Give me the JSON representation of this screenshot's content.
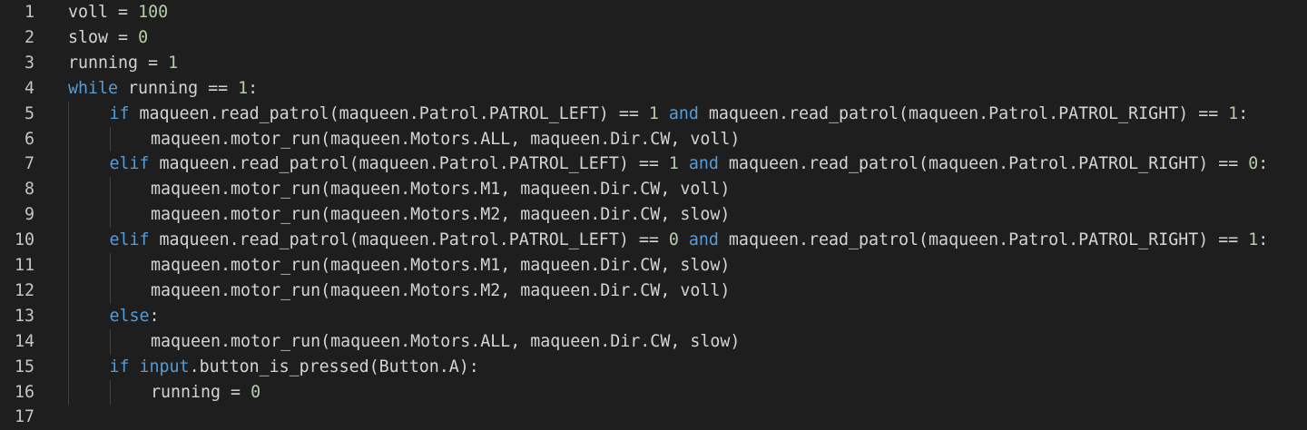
{
  "editor": {
    "lines": [
      {
        "no": "1",
        "indent": 0,
        "tokens": [
          {
            "t": "voll",
            "k": "id"
          },
          {
            "t": " = ",
            "k": "op"
          },
          {
            "t": "100",
            "k": "num"
          }
        ]
      },
      {
        "no": "2",
        "indent": 0,
        "tokens": [
          {
            "t": "slow",
            "k": "id"
          },
          {
            "t": " = ",
            "k": "op"
          },
          {
            "t": "0",
            "k": "num"
          }
        ]
      },
      {
        "no": "3",
        "indent": 0,
        "tokens": [
          {
            "t": "running",
            "k": "id"
          },
          {
            "t": " = ",
            "k": "op"
          },
          {
            "t": "1",
            "k": "num"
          }
        ]
      },
      {
        "no": "4",
        "indent": 0,
        "tokens": [
          {
            "t": "while",
            "k": "kw"
          },
          {
            "t": " running == ",
            "k": "id"
          },
          {
            "t": "1",
            "k": "num"
          },
          {
            "t": ":",
            "k": "op"
          }
        ]
      },
      {
        "no": "5",
        "indent": 1,
        "tokens": [
          {
            "t": "if",
            "k": "kw"
          },
          {
            "t": " maqueen.read_patrol(maqueen.Patrol.PATROL_LEFT) == ",
            "k": "id"
          },
          {
            "t": "1",
            "k": "num"
          },
          {
            "t": " ",
            "k": "op"
          },
          {
            "t": "and",
            "k": "kw"
          },
          {
            "t": " maqueen.read_patrol(maqueen.Patrol.PATROL_RIGHT) == ",
            "k": "id"
          },
          {
            "t": "1",
            "k": "num"
          },
          {
            "t": ":",
            "k": "op"
          }
        ]
      },
      {
        "no": "6",
        "indent": 2,
        "tokens": [
          {
            "t": "maqueen.motor_run(maqueen.Motors.ALL, maqueen.Dir.CW, voll)",
            "k": "id"
          }
        ]
      },
      {
        "no": "7",
        "indent": 1,
        "tokens": [
          {
            "t": "elif",
            "k": "kw"
          },
          {
            "t": " maqueen.read_patrol(maqueen.Patrol.PATROL_LEFT) == ",
            "k": "id"
          },
          {
            "t": "1",
            "k": "num"
          },
          {
            "t": " ",
            "k": "op"
          },
          {
            "t": "and",
            "k": "kw"
          },
          {
            "t": " maqueen.read_patrol(maqueen.Patrol.PATROL_RIGHT) == ",
            "k": "id"
          },
          {
            "t": "0",
            "k": "num"
          },
          {
            "t": ":",
            "k": "op"
          }
        ]
      },
      {
        "no": "8",
        "indent": 2,
        "tokens": [
          {
            "t": "maqueen.motor_run(maqueen.Motors.M1, maqueen.Dir.CW, voll)",
            "k": "id"
          }
        ]
      },
      {
        "no": "9",
        "indent": 2,
        "tokens": [
          {
            "t": "maqueen.motor_run(maqueen.Motors.M2, maqueen.Dir.CW, slow)",
            "k": "id"
          }
        ]
      },
      {
        "no": "10",
        "indent": 1,
        "tokens": [
          {
            "t": "elif",
            "k": "kw"
          },
          {
            "t": " maqueen.read_patrol(maqueen.Patrol.PATROL_LEFT) == ",
            "k": "id"
          },
          {
            "t": "0",
            "k": "num"
          },
          {
            "t": " ",
            "k": "op"
          },
          {
            "t": "and",
            "k": "kw"
          },
          {
            "t": " maqueen.read_patrol(maqueen.Patrol.PATROL_RIGHT) == ",
            "k": "id"
          },
          {
            "t": "1",
            "k": "num"
          },
          {
            "t": ":",
            "k": "op"
          }
        ]
      },
      {
        "no": "11",
        "indent": 2,
        "tokens": [
          {
            "t": "maqueen.motor_run(maqueen.Motors.M1, maqueen.Dir.CW, slow)",
            "k": "id"
          }
        ]
      },
      {
        "no": "12",
        "indent": 2,
        "tokens": [
          {
            "t": "maqueen.motor_run(maqueen.Motors.M2, maqueen.Dir.CW, voll)",
            "k": "id"
          }
        ]
      },
      {
        "no": "13",
        "indent": 1,
        "tokens": [
          {
            "t": "else",
            "k": "kw"
          },
          {
            "t": ":",
            "k": "op"
          }
        ]
      },
      {
        "no": "14",
        "indent": 2,
        "tokens": [
          {
            "t": "maqueen.motor_run(maqueen.Motors.ALL, maqueen.Dir.CW, slow)",
            "k": "id"
          }
        ]
      },
      {
        "no": "15",
        "indent": 1,
        "tokens": [
          {
            "t": "if",
            "k": "kw"
          },
          {
            "t": " ",
            "k": "op"
          },
          {
            "t": "input",
            "k": "kw"
          },
          {
            "t": ".button_is_pressed(Button.A):",
            "k": "id"
          }
        ]
      },
      {
        "no": "16",
        "indent": 2,
        "tokens": [
          {
            "t": "running",
            "k": "id"
          },
          {
            "t": " = ",
            "k": "op"
          },
          {
            "t": "0",
            "k": "num"
          }
        ]
      },
      {
        "no": "17",
        "indent": 0,
        "tokens": []
      }
    ]
  },
  "colors": {
    "background": "#1e1e1e",
    "keyword": "#569cd6",
    "number": "#b5cea8",
    "text": "#d4d4d4",
    "line_number": "#c5c5c5",
    "indent_guide": "#404040"
  }
}
